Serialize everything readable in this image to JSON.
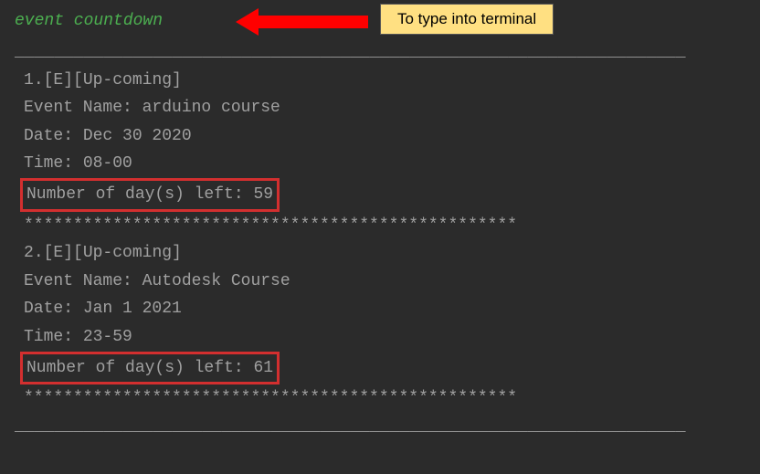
{
  "command": "event countdown",
  "annotation": "To type into terminal",
  "rule": "____________________________________________________________________",
  "separator": "**************************************************",
  "events": [
    {
      "index": "1",
      "tag": "[E][Up-coming]",
      "name_label": "Event Name: ",
      "name": "arduino course",
      "date_label": "Date: ",
      "date": "Dec 30 2020",
      "time_label": "Time: ",
      "time": "08-00",
      "days_label": "Number of day(s) left: ",
      "days": "59"
    },
    {
      "index": "2",
      "tag": "[E][Up-coming]",
      "name_label": "Event Name: ",
      "name": "Autodesk Course",
      "date_label": "Date: ",
      "date": "Jan 1 2021",
      "time_label": "Time: ",
      "time": "23-59",
      "days_label": "Number of day(s) left: ",
      "days": "61"
    }
  ]
}
